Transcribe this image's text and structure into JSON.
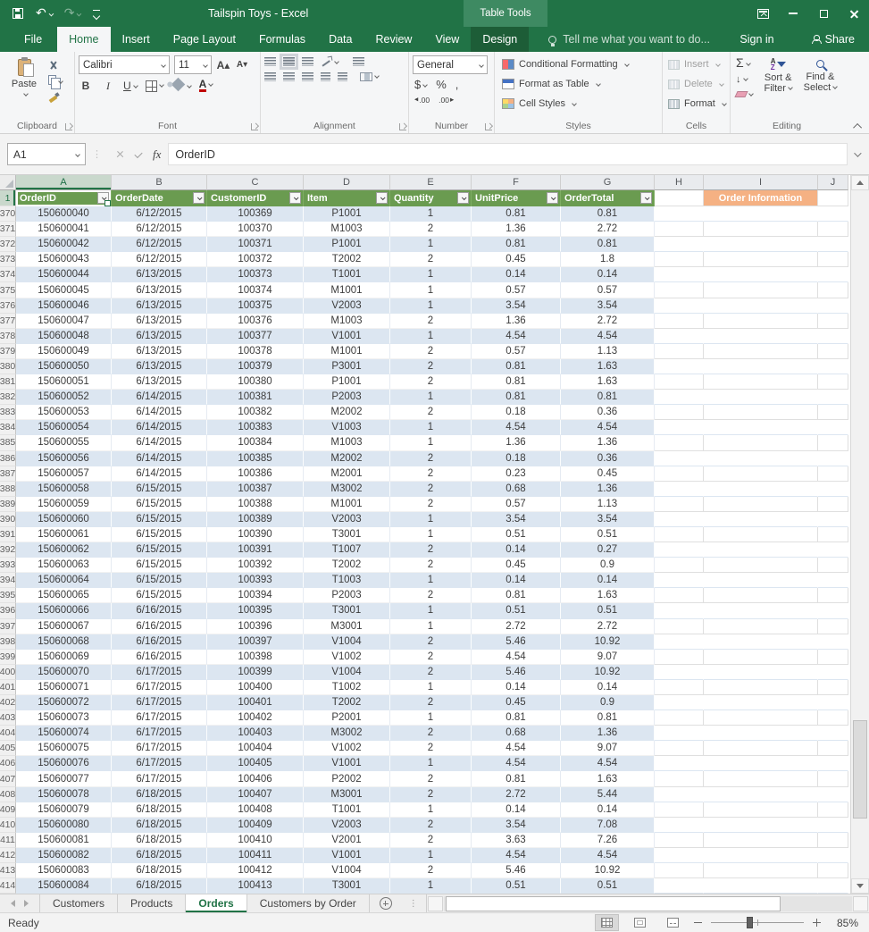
{
  "titlebar": {
    "title": "Tailspin Toys - Excel",
    "context_group": "Table Tools"
  },
  "ribbon_tabs": [
    {
      "label": "File",
      "type": "file"
    },
    {
      "label": "Home",
      "active": true
    },
    {
      "label": "Insert"
    },
    {
      "label": "Page Layout"
    },
    {
      "label": "Formulas"
    },
    {
      "label": "Data"
    },
    {
      "label": "Review"
    },
    {
      "label": "View"
    },
    {
      "label": "Design",
      "contextual": true
    }
  ],
  "tell_me": "Tell me what you want to do...",
  "account": {
    "sign_in": "Sign in",
    "share": "Share"
  },
  "ribbon": {
    "clipboard": {
      "label": "Clipboard",
      "paste": "Paste"
    },
    "font": {
      "label": "Font",
      "family": "Calibri",
      "size": "11",
      "bold": "B",
      "italic": "I",
      "underline": "U"
    },
    "alignment": {
      "label": "Alignment"
    },
    "number": {
      "label": "Number",
      "format": "General",
      "currency": "$",
      "percent": "%",
      "comma": ",",
      "decimal_label": ".00"
    },
    "styles": {
      "label": "Styles",
      "items": [
        "Conditional Formatting",
        "Format as Table",
        "Cell Styles"
      ]
    },
    "cells": {
      "label": "Cells",
      "items": [
        "Insert",
        "Delete",
        "Format"
      ]
    },
    "editing": {
      "label": "Editing",
      "sum": "Σ",
      "sort_filter_1": "Sort &",
      "sort_filter_2": "Filter",
      "find_select_1": "Find &",
      "find_select_2": "Select"
    }
  },
  "formula_bar": {
    "name_box": "A1",
    "fx": "fx",
    "content": "OrderID"
  },
  "grid": {
    "columns": [
      "A",
      "B",
      "C",
      "D",
      "E",
      "F",
      "G",
      "H",
      "I",
      "J"
    ],
    "header_row": {
      "number": "1",
      "cells": [
        "OrderID",
        "OrderDate",
        "CustomerID",
        "Item",
        "Quantity",
        "UnitPrice",
        "OrderTotal"
      ],
      "info_header": "Order Information"
    },
    "rows": [
      [
        370,
        "150600040",
        "6/12/2015",
        "100369",
        "P1001",
        "1",
        "0.81",
        "0.81"
      ],
      [
        371,
        "150600041",
        "6/12/2015",
        "100370",
        "M1003",
        "2",
        "1.36",
        "2.72"
      ],
      [
        372,
        "150600042",
        "6/12/2015",
        "100371",
        "P1001",
        "1",
        "0.81",
        "0.81"
      ],
      [
        373,
        "150600043",
        "6/12/2015",
        "100372",
        "T2002",
        "2",
        "0.45",
        "1.8"
      ],
      [
        374,
        "150600044",
        "6/13/2015",
        "100373",
        "T1001",
        "1",
        "0.14",
        "0.14"
      ],
      [
        375,
        "150600045",
        "6/13/2015",
        "100374",
        "M1001",
        "1",
        "0.57",
        "0.57"
      ],
      [
        376,
        "150600046",
        "6/13/2015",
        "100375",
        "V2003",
        "1",
        "3.54",
        "3.54"
      ],
      [
        377,
        "150600047",
        "6/13/2015",
        "100376",
        "M1003",
        "2",
        "1.36",
        "2.72"
      ],
      [
        378,
        "150600048",
        "6/13/2015",
        "100377",
        "V1001",
        "1",
        "4.54",
        "4.54"
      ],
      [
        379,
        "150600049",
        "6/13/2015",
        "100378",
        "M1001",
        "2",
        "0.57",
        "1.13"
      ],
      [
        380,
        "150600050",
        "6/13/2015",
        "100379",
        "P3001",
        "2",
        "0.81",
        "1.63"
      ],
      [
        381,
        "150600051",
        "6/13/2015",
        "100380",
        "P1001",
        "2",
        "0.81",
        "1.63"
      ],
      [
        382,
        "150600052",
        "6/14/2015",
        "100381",
        "P2003",
        "1",
        "0.81",
        "0.81"
      ],
      [
        383,
        "150600053",
        "6/14/2015",
        "100382",
        "M2002",
        "2",
        "0.18",
        "0.36"
      ],
      [
        384,
        "150600054",
        "6/14/2015",
        "100383",
        "V1003",
        "1",
        "4.54",
        "4.54"
      ],
      [
        385,
        "150600055",
        "6/14/2015",
        "100384",
        "M1003",
        "1",
        "1.36",
        "1.36"
      ],
      [
        386,
        "150600056",
        "6/14/2015",
        "100385",
        "M2002",
        "2",
        "0.18",
        "0.36"
      ],
      [
        387,
        "150600057",
        "6/14/2015",
        "100386",
        "M2001",
        "2",
        "0.23",
        "0.45"
      ],
      [
        388,
        "150600058",
        "6/15/2015",
        "100387",
        "M3002",
        "2",
        "0.68",
        "1.36"
      ],
      [
        389,
        "150600059",
        "6/15/2015",
        "100388",
        "M1001",
        "2",
        "0.57",
        "1.13"
      ],
      [
        390,
        "150600060",
        "6/15/2015",
        "100389",
        "V2003",
        "1",
        "3.54",
        "3.54"
      ],
      [
        391,
        "150600061",
        "6/15/2015",
        "100390",
        "T3001",
        "1",
        "0.51",
        "0.51"
      ],
      [
        392,
        "150600062",
        "6/15/2015",
        "100391",
        "T1007",
        "2",
        "0.14",
        "0.27"
      ],
      [
        393,
        "150600063",
        "6/15/2015",
        "100392",
        "T2002",
        "2",
        "0.45",
        "0.9"
      ],
      [
        394,
        "150600064",
        "6/15/2015",
        "100393",
        "T1003",
        "1",
        "0.14",
        "0.14"
      ],
      [
        395,
        "150600065",
        "6/15/2015",
        "100394",
        "P2003",
        "2",
        "0.81",
        "1.63"
      ],
      [
        396,
        "150600066",
        "6/16/2015",
        "100395",
        "T3001",
        "1",
        "0.51",
        "0.51"
      ],
      [
        397,
        "150600067",
        "6/16/2015",
        "100396",
        "M3001",
        "1",
        "2.72",
        "2.72"
      ],
      [
        398,
        "150600068",
        "6/16/2015",
        "100397",
        "V1004",
        "2",
        "5.46",
        "10.92"
      ],
      [
        399,
        "150600069",
        "6/16/2015",
        "100398",
        "V1002",
        "2",
        "4.54",
        "9.07"
      ],
      [
        400,
        "150600070",
        "6/17/2015",
        "100399",
        "V1004",
        "2",
        "5.46",
        "10.92"
      ],
      [
        401,
        "150600071",
        "6/17/2015",
        "100400",
        "T1002",
        "1",
        "0.14",
        "0.14"
      ],
      [
        402,
        "150600072",
        "6/17/2015",
        "100401",
        "T2002",
        "2",
        "0.45",
        "0.9"
      ],
      [
        403,
        "150600073",
        "6/17/2015",
        "100402",
        "P2001",
        "1",
        "0.81",
        "0.81"
      ],
      [
        404,
        "150600074",
        "6/17/2015",
        "100403",
        "M3002",
        "2",
        "0.68",
        "1.36"
      ],
      [
        405,
        "150600075",
        "6/17/2015",
        "100404",
        "V1002",
        "2",
        "4.54",
        "9.07"
      ],
      [
        406,
        "150600076",
        "6/17/2015",
        "100405",
        "V1001",
        "1",
        "4.54",
        "4.54"
      ],
      [
        407,
        "150600077",
        "6/17/2015",
        "100406",
        "P2002",
        "2",
        "0.81",
        "1.63"
      ],
      [
        408,
        "150600078",
        "6/18/2015",
        "100407",
        "M3001",
        "2",
        "2.72",
        "5.44"
      ],
      [
        409,
        "150600079",
        "6/18/2015",
        "100408",
        "T1001",
        "1",
        "0.14",
        "0.14"
      ],
      [
        410,
        "150600080",
        "6/18/2015",
        "100409",
        "V2003",
        "2",
        "3.54",
        "7.08"
      ],
      [
        411,
        "150600081",
        "6/18/2015",
        "100410",
        "V2001",
        "2",
        "3.63",
        "7.26"
      ],
      [
        412,
        "150600082",
        "6/18/2015",
        "100411",
        "V1001",
        "1",
        "4.54",
        "4.54"
      ],
      [
        413,
        "150600083",
        "6/18/2015",
        "100412",
        "V1004",
        "2",
        "5.46",
        "10.92"
      ],
      [
        414,
        "150600084",
        "6/18/2015",
        "100413",
        "T3001",
        "1",
        "0.51",
        "0.51"
      ]
    ]
  },
  "sheet_bar": {
    "tabs": [
      {
        "label": "Customers"
      },
      {
        "label": "Products"
      },
      {
        "label": "Orders",
        "active": true
      },
      {
        "label": "Customers by Order"
      }
    ]
  },
  "status_bar": {
    "mode": "Ready",
    "zoom_level": "85%"
  },
  "colors": {
    "title_green": "#217346",
    "table_header_green": "#6a9b50",
    "info_orange": "#f5b183",
    "band_blue": "#dce6f1"
  }
}
